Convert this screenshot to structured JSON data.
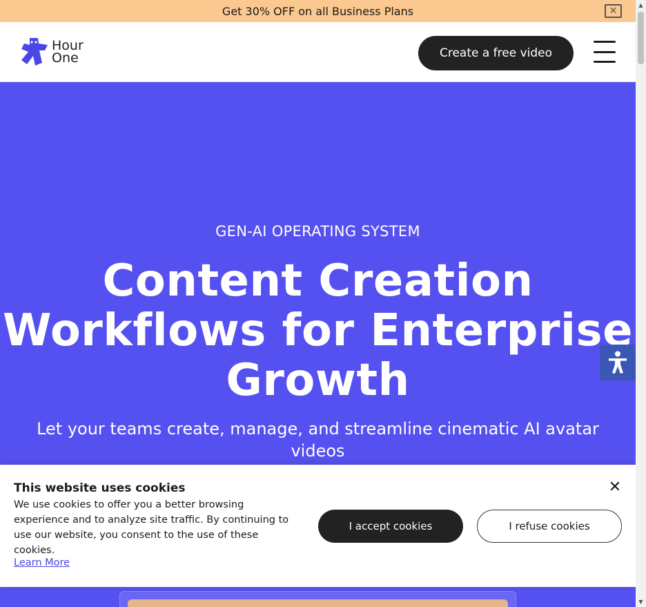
{
  "promo": {
    "text": "Get 30% OFF on all Business Plans",
    "close_icon": "close-icon"
  },
  "header": {
    "logo_line1": "Hour",
    "logo_line2": "One",
    "cta_label": "Create a free video",
    "menu_icon": "hamburger-menu-icon"
  },
  "hero": {
    "eyebrow": "GEN-AI OPERATING SYSTEM",
    "headline_line1": "Content Creation",
    "headline_line2": "Workflows for Enterprise",
    "headline_line3": "Growth",
    "subhead": "Let your teams create, manage, and streamline cinematic AI avatar videos"
  },
  "accessibility": {
    "icon": "accessibility-icon"
  },
  "cookie_banner": {
    "title": "This website uses cookies",
    "text": "We use cookies to offer you a better browsing experience and to analyze site traffic. By continuing to use our website, you consent to the use of these cookies.",
    "learn_more": "Learn More",
    "accept_label": "I accept cookies",
    "refuse_label": "I refuse cookies",
    "close_icon": "close-icon"
  },
  "colors": {
    "promo_bg": "#fbc890",
    "hero_bg": "#5550f0",
    "brand": "#4b47e6",
    "dark_button": "#222222",
    "accessibility_bg": "#3a57b6"
  }
}
